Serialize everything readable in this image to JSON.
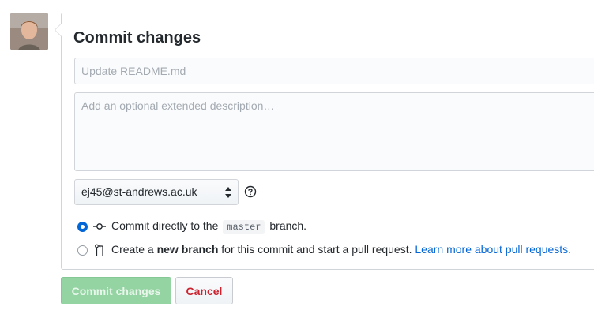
{
  "form": {
    "title": "Commit changes",
    "summary_placeholder": "Update README.md",
    "description_placeholder": "Add an optional extended description…",
    "author_email": "ej45@st-andrews.ac.uk"
  },
  "options": {
    "direct": {
      "before": "Commit directly to the",
      "branch": "master",
      "after": "branch."
    },
    "new_branch": {
      "prefix": "Create a",
      "bold": "new branch",
      "suffix": "for this commit and start a pull request.",
      "link": "Learn more about pull requests."
    }
  },
  "buttons": {
    "commit": "Commit changes",
    "cancel": "Cancel"
  },
  "colors": {
    "accent_blue": "#0366d6",
    "commit_green_disabled": "#94d3a2",
    "cancel_red": "#cb2431"
  }
}
